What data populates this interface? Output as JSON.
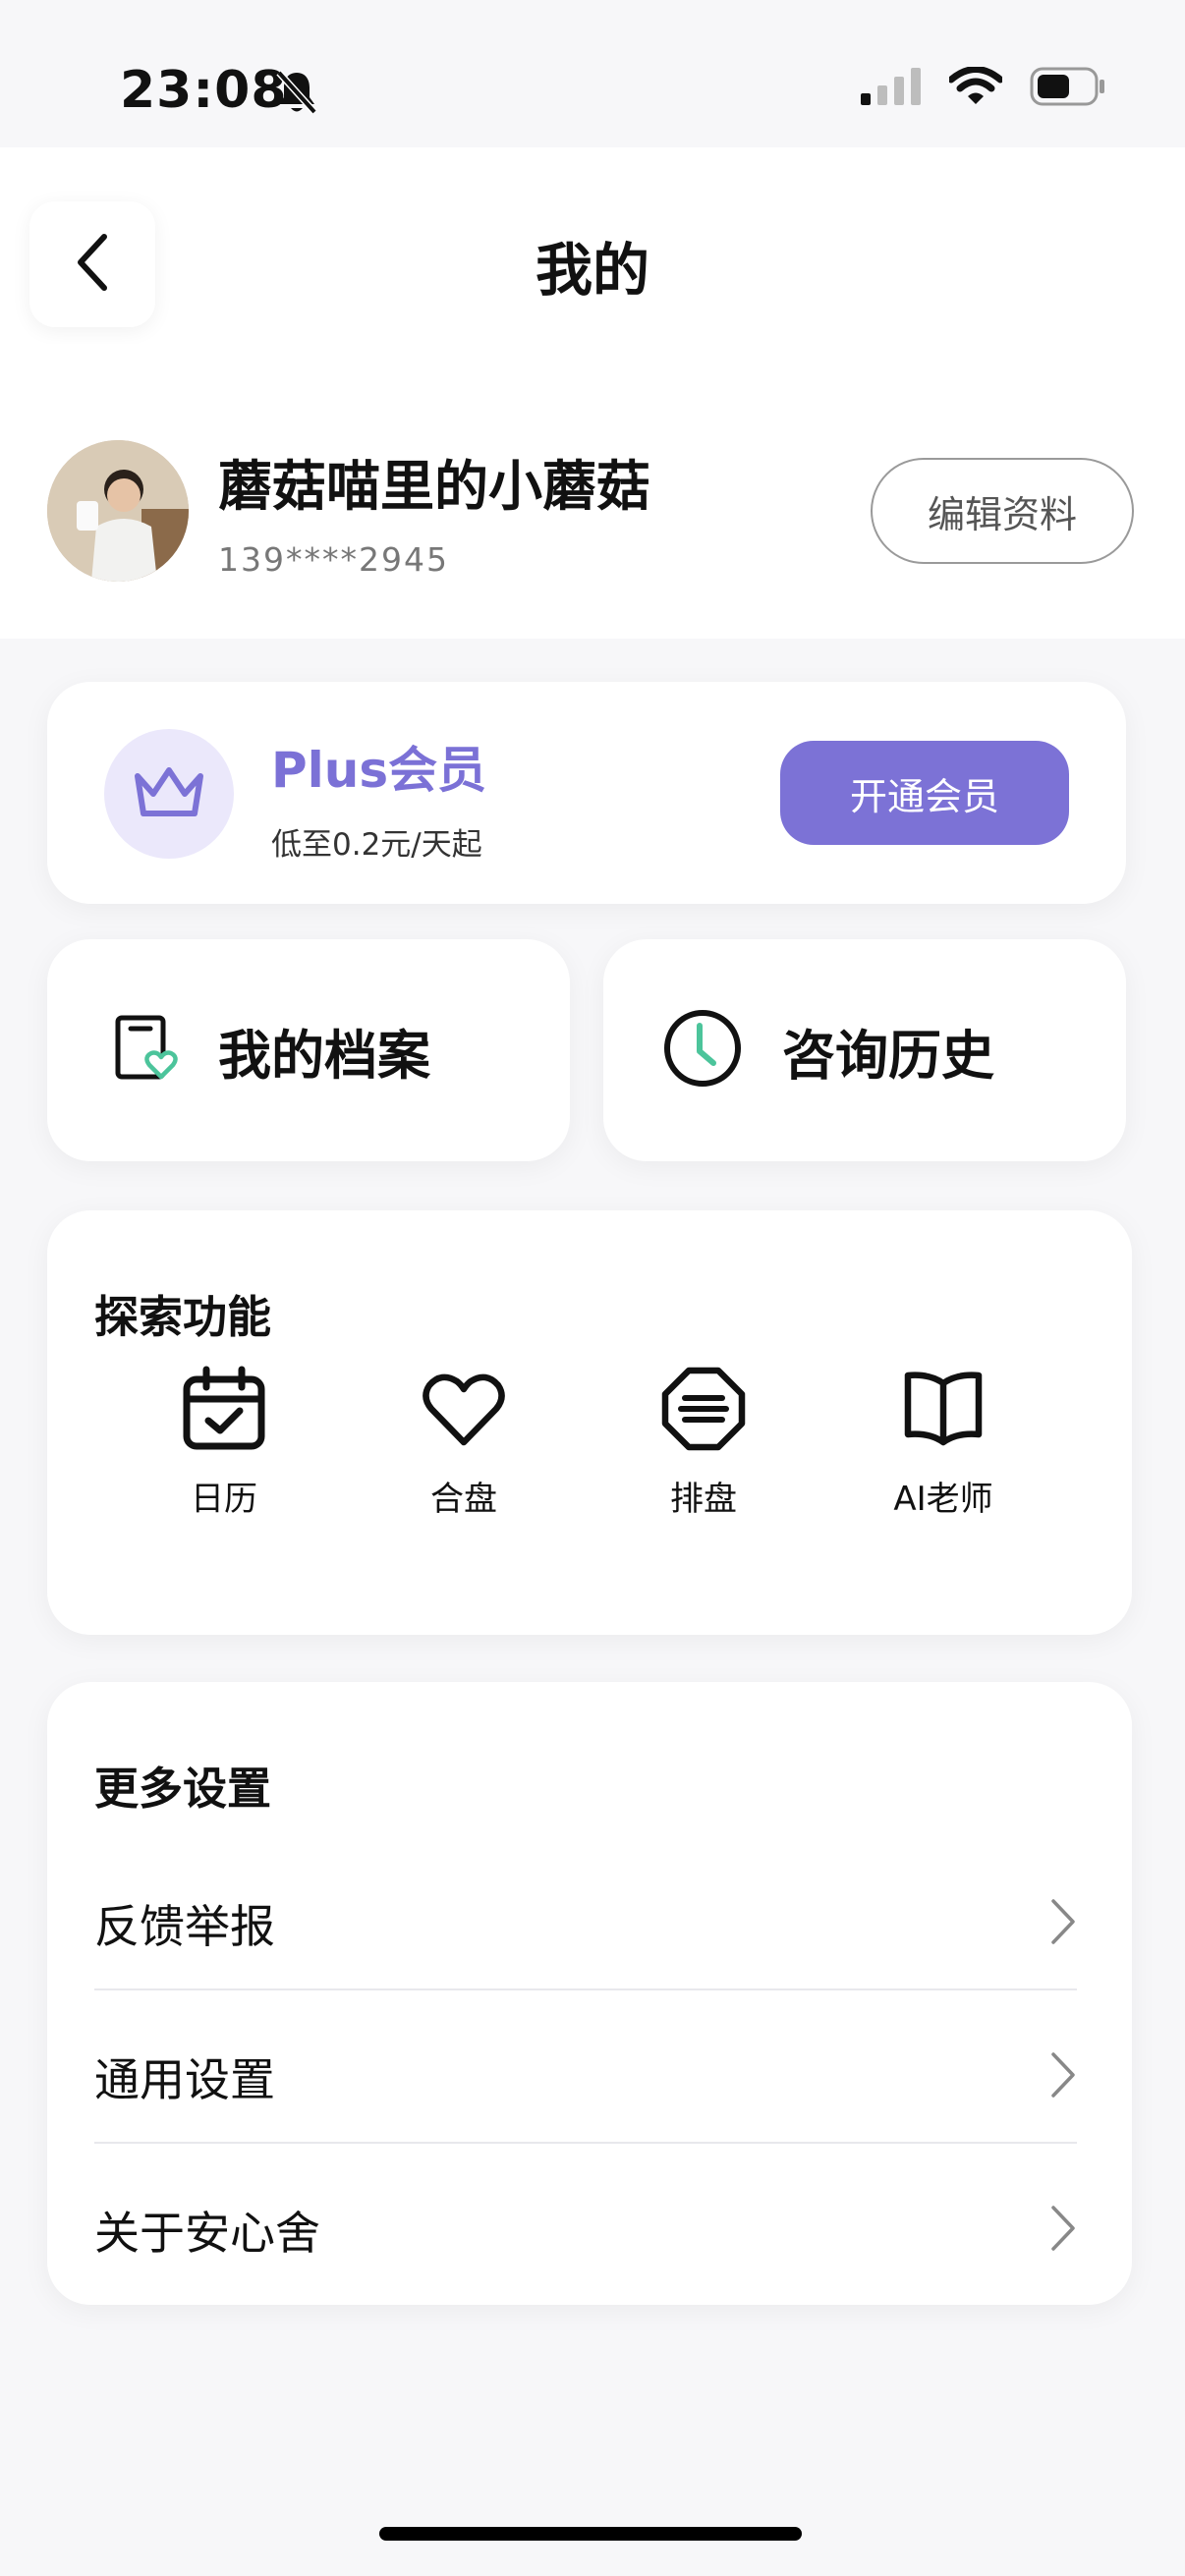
{
  "status_bar": {
    "time": "23:08",
    "icons": [
      "bell-muted-icon",
      "cellular-signal-icon",
      "wifi-icon",
      "battery-icon"
    ]
  },
  "header": {
    "title": "我的",
    "back_icon": "chevron-left-icon"
  },
  "profile": {
    "name": "蘑菇喵里的小蘑菇",
    "phone": "139****2945",
    "edit_label": "编辑资料"
  },
  "membership": {
    "title": "Plus会员",
    "subtitle": "低至0.2元/天起",
    "button_label": "开通会员",
    "icon": "crown-icon",
    "accent_color": "#7c72d6"
  },
  "quick_actions": [
    {
      "label": "我的档案",
      "icon": "profile-file-icon"
    },
    {
      "label": "咨询历史",
      "icon": "clock-icon"
    }
  ],
  "explore": {
    "title": "探索功能",
    "items": [
      {
        "label": "日历",
        "icon": "calendar-icon"
      },
      {
        "label": "合盘",
        "icon": "heart-icon"
      },
      {
        "label": "排盘",
        "icon": "chart-badge-icon"
      },
      {
        "label": "AI老师",
        "icon": "book-icon"
      }
    ]
  },
  "settings": {
    "title": "更多设置",
    "items": [
      {
        "label": "反馈举报"
      },
      {
        "label": "通用设置"
      },
      {
        "label": "关于安心舍"
      }
    ]
  }
}
